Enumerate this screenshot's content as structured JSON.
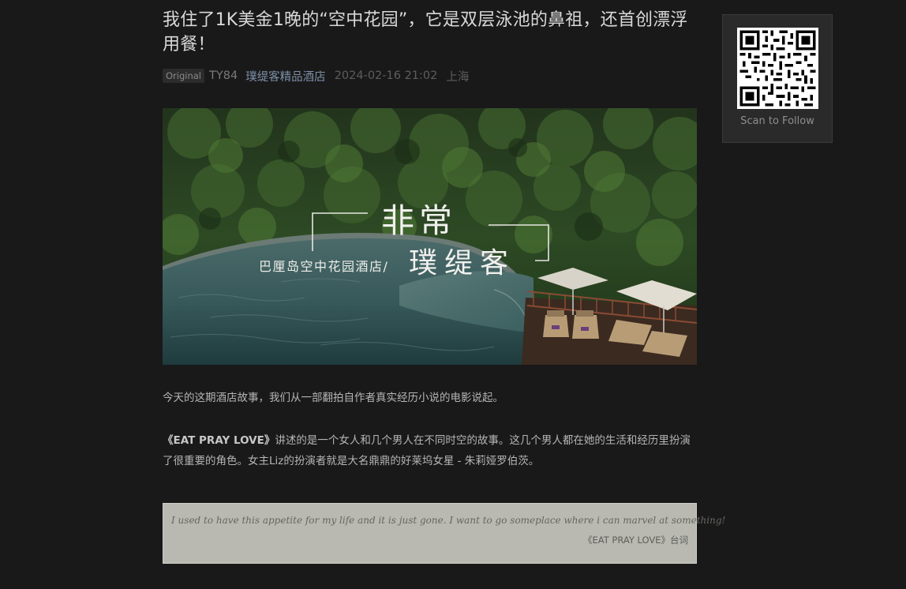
{
  "article": {
    "title": "我住了1K美金1晚的“空中花园”，它是双层泳池的鼻祖，还首创漂浮用餐！",
    "original_tag": "Original",
    "author": "TY84",
    "account": "璞缇客精品酒店",
    "date": "2024-02-16 21:02",
    "location": "上海"
  },
  "cover": {
    "headline": "非常",
    "brand": "璞缇客",
    "subtitle": "巴厘岛空中花园酒店/"
  },
  "body": {
    "paragraph1": "今天的这期酒店故事，我们从一部翻拍自作者真实经历小说的电影说起。",
    "paragraph2_title": "《EAT PRAY LOVE》",
    "paragraph2_text": "讲述的是一个女人和几个男人在不同时空的故事。这几个男人都在她的生活和经历里扮演了很重要的角色。女主Liz的扮演者就是大名鼎鼎的好莱坞女星 - 朱莉娅罗伯茨。",
    "quote_text": "I used to have this appetite for my life and it is just gone. I want to go someplace where i can marvel at something!",
    "quote_source": "《EAT PRAY LOVE》台词"
  },
  "sidebar": {
    "qr_label": "Scan to Follow"
  }
}
